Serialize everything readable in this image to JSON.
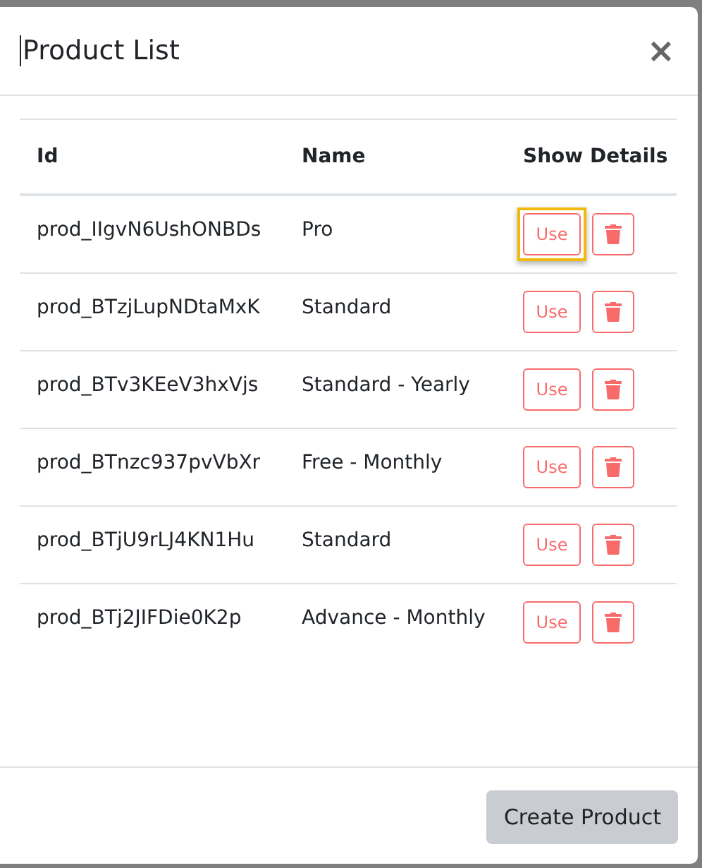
{
  "modal": {
    "title": "Product List",
    "close": "×"
  },
  "table": {
    "columns": [
      "Id",
      "Name",
      "Show Details"
    ],
    "rows": [
      {
        "id": "prod_IIgvN6UshONBDs",
        "name": "Pro",
        "action": "Use",
        "highlighted": true
      },
      {
        "id": "prod_BTzjLupNDtaMxK",
        "name": "Standard",
        "action": "Use",
        "highlighted": false
      },
      {
        "id": "prod_BTv3KEeV3hxVjs",
        "name": "Standard - Yearly",
        "action": "Use",
        "highlighted": false
      },
      {
        "id": "prod_BTnzc937pvVbXr",
        "name": "Free - Monthly",
        "action": "Use",
        "highlighted": false
      },
      {
        "id": "prod_BTjU9rLJ4KN1Hu",
        "name": "Standard",
        "action": "Use",
        "highlighted": false
      },
      {
        "id": "prod_BTj2JIFDie0K2p",
        "name": "Advance - Monthly",
        "action": "Use",
        "highlighted": false
      }
    ]
  },
  "footer": {
    "button": "Create Product"
  }
}
